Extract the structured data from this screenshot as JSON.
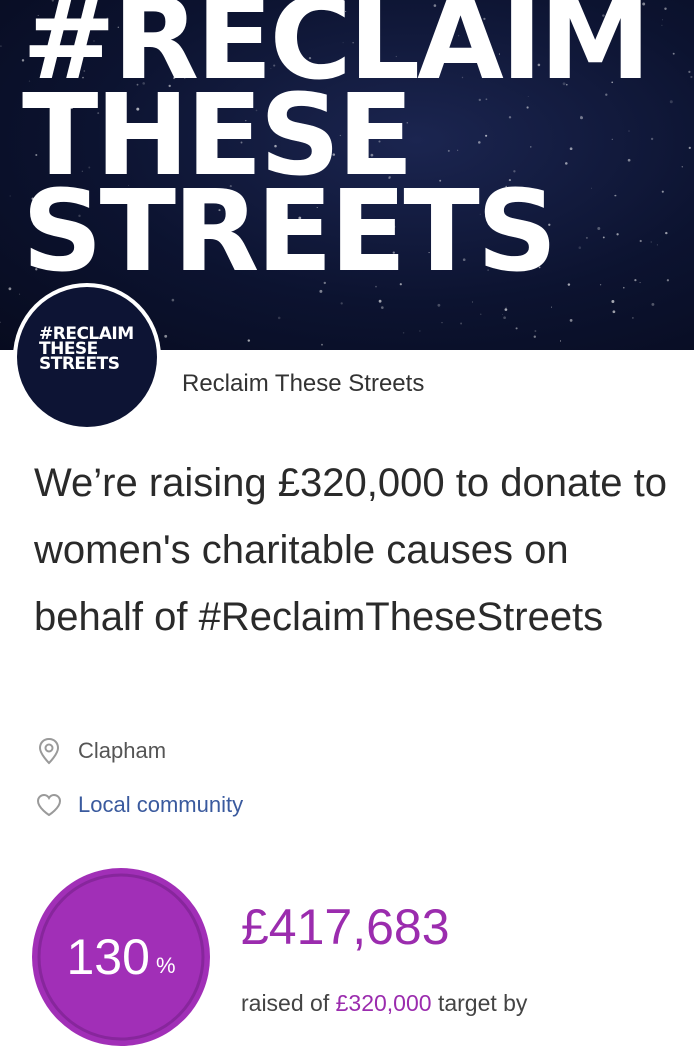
{
  "banner": {
    "title_lines": [
      "#RECLAIM",
      "THESE",
      "STREETS"
    ]
  },
  "avatar": {
    "lines": [
      "#RECLAIM",
      "THESE",
      "STREETS"
    ]
  },
  "organizer": {
    "name": "Reclaim These Streets"
  },
  "campaign": {
    "headline": "We’re raising £320,000 to donate to women's charitable causes on behalf of #ReclaimTheseStreets",
    "location": "Clapham",
    "category": "Local community"
  },
  "icons": {
    "location": "location-pin-icon",
    "category": "heart-icon"
  },
  "progress": {
    "percent": "130",
    "percent_sign": "%",
    "percent_value": 130,
    "amount_raised": "£417,683",
    "raised_prefix": "raised of",
    "target": "£320,000",
    "raised_suffix": "target by"
  },
  "colors": {
    "accent": "#9b2cae",
    "ring_fill": "#a12fb7",
    "ring_stroke": "#7c2290",
    "banner_bg": "#0c1330",
    "link": "#3a5a9e"
  }
}
